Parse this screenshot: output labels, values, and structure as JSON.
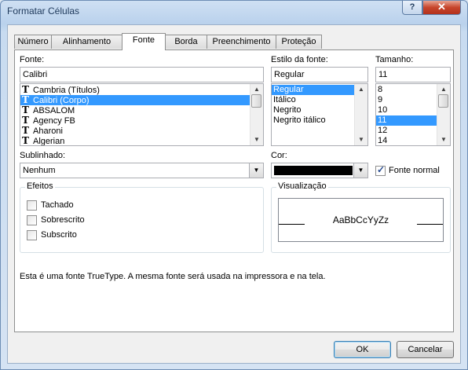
{
  "window": {
    "title": "Formatar Células",
    "help_label": "?",
    "close_label": "✕"
  },
  "tabs": [
    {
      "label": "Número"
    },
    {
      "label": "Alinhamento"
    },
    {
      "label": "Fonte"
    },
    {
      "label": "Borda"
    },
    {
      "label": "Preenchimento"
    },
    {
      "label": "Proteção"
    }
  ],
  "active_tab": "Fonte",
  "font": {
    "label": "Fonte:",
    "value": "Calibri",
    "items": [
      "Cambria (Títulos)",
      "Calibri (Corpo)",
      "ABSALOM",
      "Agency FB",
      "Aharoni",
      "Algerian"
    ],
    "selected": "Calibri (Corpo)"
  },
  "style": {
    "label": "Estilo da fonte:",
    "value": "Regular",
    "items": [
      "Regular",
      "Itálico",
      "Negrito",
      "Negrito itálico"
    ],
    "selected": "Regular"
  },
  "size": {
    "label": "Tamanho:",
    "value": "11",
    "items": [
      "8",
      "9",
      "10",
      "11",
      "12",
      "14"
    ],
    "selected": "11"
  },
  "underline": {
    "label": "Sublinhado:",
    "value": "Nenhum"
  },
  "color": {
    "label": "Cor:",
    "swatch": "#000000",
    "normal_font_label": "Fonte normal",
    "normal_font_checked": true
  },
  "effects": {
    "title": "Efeitos",
    "items": [
      {
        "label": "Tachado",
        "checked": false
      },
      {
        "label": "Sobrescrito",
        "checked": false
      },
      {
        "label": "Subscrito",
        "checked": false
      }
    ]
  },
  "preview": {
    "title": "Visualização",
    "sample": "AaBbCcYyZz"
  },
  "info_text": "Esta é uma fonte TrueType. A mesma fonte será usada na impressora e na tela.",
  "buttons": {
    "ok": "OK",
    "cancel": "Cancelar"
  },
  "colors": {
    "selection": "#3399ff",
    "accent": "#3c7fb1"
  }
}
